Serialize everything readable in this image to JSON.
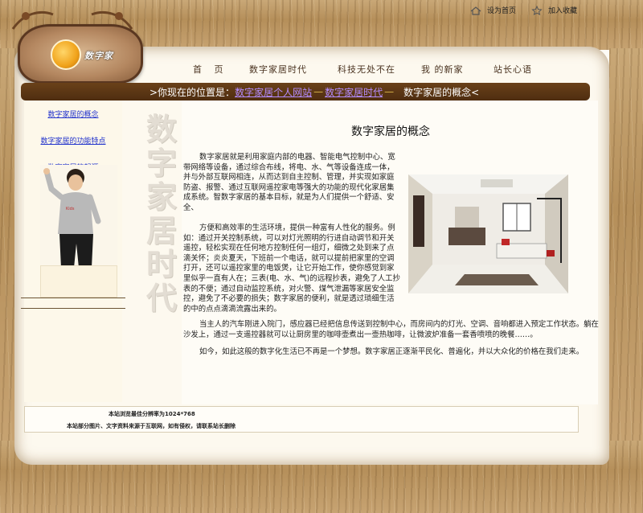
{
  "top_links": [
    {
      "label": "设为首页",
      "icon": "home-icon"
    },
    {
      "label": "加入收藏",
      "icon": "star-icon"
    }
  ],
  "logo": {
    "text": "数字家"
  },
  "nav": [
    {
      "label": "首 页"
    },
    {
      "label": "数字家居时代"
    },
    {
      "label": "科技无处不在"
    },
    {
      "label": "我 的新家"
    },
    {
      "label": "站长心语"
    }
  ],
  "breadcrumb": {
    "prefix": ">你现在的位置是：",
    "items": [
      "数字家居个人网站",
      "数字家居时代"
    ],
    "separator": "—",
    "current": "数字家居的概念<"
  },
  "sidebar": {
    "links": [
      "数字家居的概念",
      "数字家居的功能特点",
      "数字家居的起源"
    ]
  },
  "vertical_title": "数字家居时代",
  "article": {
    "title": "数字家居的概念",
    "paragraphs": [
      "数字家居就是利用家庭内部的电器、智能电气控制中心、宽带网络等设备，通过综合布线，将电、水、气等设备连成一体，并与外部互联网相连，从而达到自主控制、管理，并实现如家庭防盗、报警、通过互联网遥控家电等强大的功能的现代化家居集成系统。智数字家居的基本目标，就是为人们提供一个舒适、安全、",
      "方便和高效率的生活环境，提供一种富有人性化的服务。例如：通过开关控制系统，可以对灯光照明的行进自动调节和开关遥控，轻松实现在任何地方控制任何一组灯，细微之处到来了点滴关怀；炎炎夏天，下班前一个电话，就可以提前把家里的空调打开，还可以遥控家里的电饭煲，让它开始工作，使你感觉到家里似乎一直有人在；三表(电、水、气)的远程抄表，避免了人工抄表的不便；通过自动监控系统，对火警、煤气泄漏等家居安全监控，避免了不必要的损失；数字家居的便利，就是透过琐细生活的中的点点滴滴流露出来的。",
      "当主人的汽车刚进入院门，感应器已经把信息传送到控制中心，而房间内的灯光、空调、音响都进入预定工作状态。躺在沙发上，通过一支遥控器就可以让厨房里的咖啡壶煮出一壶热咖啡，让微波炉准备一套香喷喷的晚餐……。",
      "如今，如此这般的数字化生活已不再是一个梦想。数字家居正逐渐平民化、普遍化，并以大众化的价格在我们走来。"
    ]
  },
  "footer": {
    "line1": "本站浏览最佳分辨率为1024*768",
    "line2": "本站部分图片、文字资料来源于互联网，如有侵权，请联系站长删除"
  },
  "colors": {
    "wood": "#b58f5a",
    "crumb_bar": "#5a3515",
    "link": "#2233cc",
    "crumb_link": "#b48cff"
  }
}
